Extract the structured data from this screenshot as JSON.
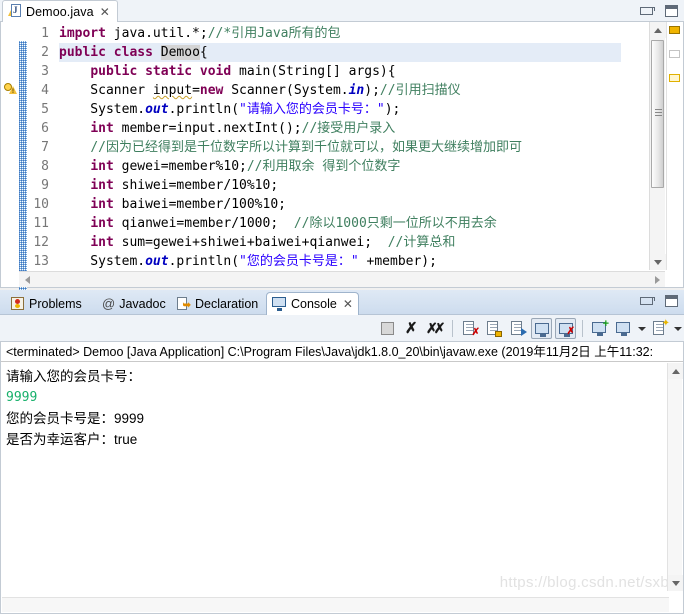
{
  "editor": {
    "tab": {
      "filename": "Demoo.java",
      "icon": "java-file-warning-icon",
      "close": "✕"
    },
    "line_numbers": [
      "1",
      "2",
      "3",
      "4",
      "5",
      "6",
      "7",
      "8",
      "9",
      "10",
      "11",
      "12",
      "13"
    ],
    "code_lines": [
      "import java.util.*;//*引用Java所有的包",
      "public class Demoo{",
      "    public static void main(String[] args){",
      "    Scanner input=new Scanner(System.in);//引用扫描仪",
      "    System.out.println(\"请输入您的会员卡号：\");",
      "    int member=input.nextInt();//接受用户录入",
      "    //因为已经得到是千位数字所以计算到千位就可以，如果更大继续增加即可",
      "    int gewei=member%10;//利用取余 得到个位数字",
      "    int shiwei=member/10%10;",
      "    int baiwei=member/100%10;",
      "    int qianwei=member/1000;  //除以1000只剩一位所以不用去余",
      "    int sum=gewei+shiwei+baiwei+qianwei;  //计算总和",
      "    System.out.println(\"您的会员卡号是：\" +member);"
    ]
  },
  "console_view": {
    "tabs": [
      {
        "label": "Problems",
        "icon": "problems-icon",
        "active": false
      },
      {
        "label": "Javadoc",
        "icon": "at-icon",
        "active": false
      },
      {
        "label": "Declaration",
        "icon": "declaration-icon",
        "active": false
      },
      {
        "label": "Console",
        "icon": "console-icon",
        "active": true,
        "close": "✕"
      }
    ],
    "window_buttons": {
      "minimize": "minimize-button",
      "maximize": "maximize-button"
    },
    "toolbar_icons": [
      "terminate-icon",
      "remove-launch-icon",
      "remove-all-terminated-icon",
      "clear-console-icon",
      "scroll-lock-icon",
      "show-console-on-output-icon",
      "pin-console-icon",
      "display-selected-console-icon",
      "open-console-icon",
      "open-console-dropdown-icon",
      "new-console-view-icon",
      "new-console-view-dropdown-icon"
    ],
    "terminated_line": "<terminated> Demoo [Java Application] C:\\Program Files\\Java\\jdk1.8.0_20\\bin\\javaw.exe (2019年11月2日 上午11:32:",
    "output": [
      {
        "text": "请输入您的会员卡号：",
        "kind": "stdout"
      },
      {
        "text": "9999",
        "kind": "stdin"
      },
      {
        "text": "您的会员卡号是：9999",
        "kind": "stdout"
      },
      {
        "text": "是否为幸运客户：true",
        "kind": "stdout"
      }
    ]
  },
  "editor_window_buttons": {
    "minimize": "minimize-button",
    "maximize": "maximize-button"
  },
  "watermark": "https://blog.csdn.net/sxb",
  "colors": {
    "keyword": "#7f0055",
    "comment": "#3f7f5f",
    "string": "#2a00ff",
    "field": "#0000c0",
    "stdin_green": "#17b06b",
    "tab_active_bg": "#ffffff",
    "panel_bg": "#eff3f8",
    "highlight_line": "#e4ecf7",
    "change_bar": "#5c9bd6"
  }
}
